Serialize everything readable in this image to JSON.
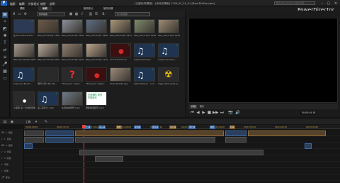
{
  "app": {
    "logo_text": "P",
    "menu": [
      "檔案",
      "編輯",
      "外掛程式",
      "檢視",
      "說明"
    ],
    "doc_title": "(已儲存/新專案) - [未命名專案] 1156_04_29_01 [BackFilePro.pdss]",
    "search_placeholder": "搜尋 Directorzone 線上資源...",
    "brand": "PowerDirector",
    "window_controls": {
      "minimize": "–",
      "maximize": "▢",
      "close": "✕"
    }
  },
  "mode_tabs": [
    {
      "label": "擷取",
      "active": false
    },
    {
      "label": "編輯",
      "active": true
    },
    {
      "label": "製作影片",
      "active": false
    },
    {
      "label": "製作光碟",
      "active": false
    }
  ],
  "library": {
    "filter": "所有媒體",
    "search_placeholder": "搜尋媒體庫",
    "items": [
      {
        "caption": "在 Dm Microsoft Fi...",
        "kind": "video",
        "color": "#2c3a55",
        "check": true
      },
      {
        "caption": "IMG_20171001 1436...",
        "kind": "photo",
        "color": "#6b5a46",
        "check": true
      },
      {
        "caption": "IMG_20171001 1506...",
        "kind": "photo",
        "color": "#8a8f99",
        "check": true
      },
      {
        "caption": "IMG_20171001 1838...",
        "kind": "photo",
        "color": "#5b6d85",
        "check": true
      },
      {
        "caption": "IMG_20171001 1921...",
        "kind": "photo",
        "color": "#a89778",
        "check": true
      },
      {
        "caption": "IMG_20171001 1926...",
        "kind": "photo",
        "color": "#7d8a6a",
        "check": true
      },
      {
        "caption": "IMG_20171001 1946...",
        "kind": "photo",
        "color": "#9c8b74",
        "check": true
      },
      {
        "caption": "IMG_20171002 0928...",
        "kind": "photo",
        "color": "#a3978a",
        "check": true
      },
      {
        "caption": "IMG_20171002 0945...",
        "kind": "photo",
        "color": "#b7a99a",
        "check": true
      },
      {
        "caption": "IMG_20171002 1026...",
        "kind": "photo",
        "color": "#8f7e6e",
        "check": true
      },
      {
        "caption": "IMG_20171002 1110...",
        "kind": "photo",
        "color": "#b9a58c",
        "check": true
      },
      {
        "caption": "???????????????",
        "kind": "red",
        "color": "#3a0f0f",
        "check": true
      },
      {
        "caption": "Captured Event...",
        "kind": "audio",
        "color": "#1e3450",
        "check": true
      },
      {
        "caption": "Captured Event...",
        "kind": "audio",
        "color": "#1e3450",
        "check": true
      },
      {
        "caption": "Captured Event...",
        "kind": "audio",
        "color": "#1e3450",
        "check": true
      },
      {
        "caption": "滑杆小車3 Bri Ma...",
        "kind": "dark",
        "color": "#2a2a2a",
        "check": false
      },
      {
        "caption": "*Program* Captu...",
        "kind": "question",
        "color": "#2a2a2a",
        "check": false
      },
      {
        "caption": "*Program* Captu...",
        "kind": "red",
        "color": "#3a0f0f",
        "check": false
      },
      {
        "caption": "Fossil.Eres51.jpg",
        "kind": "photo",
        "color": "#9a8a78",
        "check": true
      },
      {
        "caption": "Lifeirritation1 - 2.m...",
        "kind": "audio",
        "color": "#1e3450",
        "check": true
      },
      {
        "caption": "Tigere Microsoft_ly...",
        "kind": "radiation",
        "color": "#2a2a2a",
        "check": false
      },
      {
        "caption": "小旋風 第一次收起雨傘.wav",
        "kind": "dot",
        "color": "#2a2a2a",
        "check": false
      },
      {
        "caption": "第三段影片.mp3",
        "kind": "audio",
        "color": "#1e3450",
        "check": true
      },
      {
        "caption": "在週末的我們.mp4",
        "kind": "photo",
        "color": "#6f7a88",
        "check": true
      },
      {
        "caption": "滑板故事配音.mp4",
        "kind": "text",
        "color": "#ffffff",
        "check": false
      }
    ],
    "text_tile": "在家鄉的 我們 享受時光"
  },
  "preview": {
    "tabs": [
      {
        "label": "片段",
        "active": true
      },
      {
        "label": "影片",
        "active": false
      }
    ],
    "timecode": "00;00;04;16",
    "controls": [
      "⏮",
      "◀",
      "▶",
      "■",
      "▶▶",
      "⏭",
      "📷",
      "🔊"
    ]
  },
  "timeline": {
    "toolbar_label": "工具",
    "ruler": [
      "00;00;00;00",
      "00;00;33;10",
      "00;01;06;20",
      "00;01;40;00",
      "00;02;13;10",
      "00;02;46;20",
      "00;03;20;00",
      "00;03;53;10",
      "00;04;26;20",
      "00;05;00;00"
    ],
    "tracks": [
      {
        "label": "1. 視訊",
        "icon": "🎞"
      },
      {
        "label": "1. 音訊",
        "icon": "♪"
      },
      {
        "label": "2. 視訊",
        "icon": "🎞"
      },
      {
        "label": "2. 音訊",
        "icon": "♪"
      },
      {
        "label": "3. 音訊",
        "icon": "♪"
      },
      {
        "label": "字幕",
        "icon": "T"
      },
      {
        "label": "音樂",
        "icon": "♪"
      },
      {
        "label": "旁白",
        "icon": "🎤"
      }
    ],
    "markers": [
      "第二段",
      "第三段",
      "開始",
      "第四段",
      "第五段",
      "第六段",
      "第七段",
      "總結",
      "結尾"
    ]
  }
}
